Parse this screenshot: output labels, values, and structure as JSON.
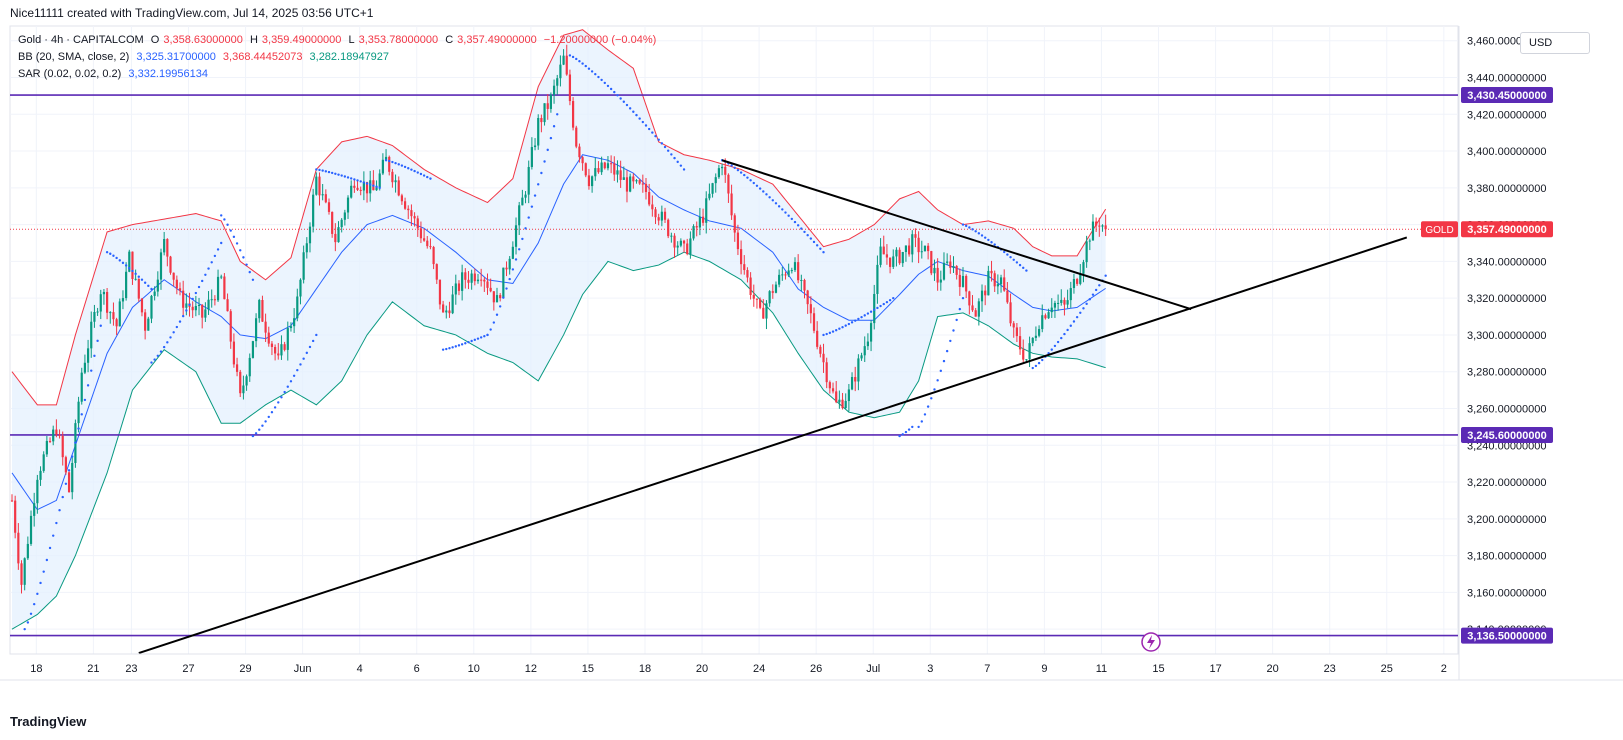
{
  "header": {
    "attribution": "Nice11111 created with TradingView.com, Jul 14, 2025 03:56 UTC+1"
  },
  "legend": {
    "symbol": "Gold · 4h · CAPITALCOM",
    "o_label": "O",
    "o_value": "3,358.63000000",
    "h_label": "H",
    "h_value": "3,359.49000000",
    "l_label": "L",
    "l_value": "3,353.78000000",
    "c_label": "C",
    "c_value": "3,357.49000000",
    "change": "−1.20000000 (−0.04%)",
    "bb_label": "BB (20, SMA, close, 2)",
    "bb_mid": "3,325.31700000",
    "bb_upper": "3,368.44452073",
    "bb_lower": "3,282.18947927",
    "sar_label": "SAR (0.02, 0.02, 0.2)",
    "sar_value": "3,332.19956134"
  },
  "currency": "USD",
  "brand": "TradingView",
  "colors": {
    "up": "#089981",
    "down": "#f23645",
    "bb_upper": "#f23645",
    "bb_lower": "#089981",
    "bb_mid": "#2962ff",
    "bb_fill": "#e3effd",
    "sar": "#2962ff",
    "level": "#5b2ab5",
    "trendline": "#000000",
    "price_line": "#f23645"
  },
  "chart_data": {
    "type": "candlestick",
    "title": "Gold · 4h · CAPITALCOM",
    "y_axis": {
      "ylim": [
        3126.5,
        3468
      ],
      "ticks": [
        3140,
        3160,
        3180,
        3200,
        3220,
        3240,
        3260,
        3280,
        3300,
        3320,
        3340,
        3360,
        3380,
        3400,
        3420,
        3440,
        3460
      ],
      "tick_labels": [
        "3,140.00000000",
        "3,160.00000000",
        "3,180.00000000",
        "3,200.00000000",
        "3,220.00000000",
        "3,240.00000000",
        "3,260.00000000",
        "3,280.00000000",
        "3,300.00000000",
        "3,320.00000000",
        "3,340.00000000",
        "3,360.00000000",
        "3,380.00000000",
        "3,400.00000000",
        "3,420.00000000",
        "3,440.00000000",
        "3,460.00000000"
      ]
    },
    "x_axis": {
      "ticks": [
        {
          "bar": 2,
          "label": "18"
        },
        {
          "bar": 20,
          "label": "21"
        },
        {
          "bar": 32,
          "label": "23"
        },
        {
          "bar": 50,
          "label": "27"
        },
        {
          "bar": 68,
          "label": "29"
        },
        {
          "bar": 86,
          "label": "Jun"
        },
        {
          "bar": 104,
          "label": "4"
        },
        {
          "bar": 122,
          "label": "6"
        },
        {
          "bar": 140,
          "label": "10"
        },
        {
          "bar": 158,
          "label": "12"
        },
        {
          "bar": 176,
          "label": "15"
        },
        {
          "bar": 194,
          "label": "18"
        },
        {
          "bar": 212,
          "label": "20"
        },
        {
          "bar": 230,
          "label": "24"
        },
        {
          "bar": 248,
          "label": "26"
        },
        {
          "bar": 266,
          "label": "Jul"
        },
        {
          "bar": 284,
          "label": "3"
        },
        {
          "bar": 302,
          "label": "7"
        },
        {
          "bar": 320,
          "label": "9"
        },
        {
          "bar": 338,
          "label": "11"
        },
        {
          "bar": 356,
          "label": "15"
        },
        {
          "bar": 374,
          "label": "17"
        },
        {
          "bar": 392,
          "label": "20"
        },
        {
          "bar": 410,
          "label": "23"
        },
        {
          "bar": 428,
          "label": "25"
        },
        {
          "bar": 446,
          "label": "2"
        }
      ]
    },
    "price_anchors": [
      {
        "bar": 0,
        "price": 3210
      },
      {
        "bar": 3,
        "price": 3165
      },
      {
        "bar": 8,
        "price": 3225
      },
      {
        "bar": 14,
        "price": 3250
      },
      {
        "bar": 18,
        "price": 3215
      },
      {
        "bar": 22,
        "price": 3280
      },
      {
        "bar": 28,
        "price": 3325
      },
      {
        "bar": 33,
        "price": 3305
      },
      {
        "bar": 37,
        "price": 3342
      },
      {
        "bar": 42,
        "price": 3305
      },
      {
        "bar": 48,
        "price": 3350
      },
      {
        "bar": 53,
        "price": 3320
      },
      {
        "bar": 60,
        "price": 3310
      },
      {
        "bar": 66,
        "price": 3330
      },
      {
        "bar": 72,
        "price": 3265
      },
      {
        "bar": 78,
        "price": 3315
      },
      {
        "bar": 84,
        "price": 3285
      },
      {
        "bar": 90,
        "price": 3318
      },
      {
        "bar": 96,
        "price": 3385
      },
      {
        "bar": 102,
        "price": 3352
      },
      {
        "bar": 108,
        "price": 3385
      },
      {
        "bar": 114,
        "price": 3378
      },
      {
        "bar": 118,
        "price": 3395
      },
      {
        "bar": 126,
        "price": 3365
      },
      {
        "bar": 132,
        "price": 3345
      },
      {
        "bar": 136,
        "price": 3310
      },
      {
        "bar": 142,
        "price": 3330
      },
      {
        "bar": 148,
        "price": 3335
      },
      {
        "bar": 153,
        "price": 3318
      },
      {
        "bar": 158,
        "price": 3352
      },
      {
        "bar": 162,
        "price": 3380
      },
      {
        "bar": 166,
        "price": 3415
      },
      {
        "bar": 170,
        "price": 3428
      },
      {
        "bar": 174,
        "price": 3450
      },
      {
        "bar": 178,
        "price": 3405
      },
      {
        "bar": 182,
        "price": 3385
      },
      {
        "bar": 188,
        "price": 3392
      },
      {
        "bar": 194,
        "price": 3382
      },
      {
        "bar": 200,
        "price": 3378
      },
      {
        "bar": 206,
        "price": 3360
      },
      {
        "bar": 212,
        "price": 3345
      },
      {
        "bar": 218,
        "price": 3365
      },
      {
        "bar": 224,
        "price": 3395
      },
      {
        "bar": 228,
        "price": 3355
      },
      {
        "bar": 232,
        "price": 3330
      },
      {
        "bar": 236,
        "price": 3310
      },
      {
        "bar": 240,
        "price": 3325
      },
      {
        "bar": 246,
        "price": 3340
      },
      {
        "bar": 252,
        "price": 3310
      },
      {
        "bar": 256,
        "price": 3285
      },
      {
        "bar": 260,
        "price": 3262
      },
      {
        "bar": 264,
        "price": 3268
      },
      {
        "bar": 270,
        "price": 3300
      },
      {
        "bar": 274,
        "price": 3345
      },
      {
        "bar": 278,
        "price": 3340
      },
      {
        "bar": 284,
        "price": 3350
      },
      {
        "bar": 288,
        "price": 3345
      },
      {
        "bar": 292,
        "price": 3330
      },
      {
        "bar": 296,
        "price": 3340
      },
      {
        "bar": 300,
        "price": 3328
      },
      {
        "bar": 304,
        "price": 3312
      },
      {
        "bar": 308,
        "price": 3330
      },
      {
        "bar": 312,
        "price": 3330
      },
      {
        "bar": 316,
        "price": 3300
      },
      {
        "bar": 320,
        "price": 3287
      },
      {
        "bar": 324,
        "price": 3308
      },
      {
        "bar": 328,
        "price": 3318
      },
      {
        "bar": 332,
        "price": 3315
      },
      {
        "bar": 336,
        "price": 3332
      },
      {
        "bar": 340,
        "price": 3355
      },
      {
        "bar": 343,
        "price": 3362
      },
      {
        "bar": 345,
        "price": 3357.49
      }
    ],
    "bollinger": {
      "upper": [
        {
          "bar": 0,
          "price": 3280
        },
        {
          "bar": 8,
          "price": 3262
        },
        {
          "bar": 14,
          "price": 3262
        },
        {
          "bar": 20,
          "price": 3300
        },
        {
          "bar": 30,
          "price": 3356
        },
        {
          "bar": 38,
          "price": 3360
        },
        {
          "bar": 48,
          "price": 3363
        },
        {
          "bar": 58,
          "price": 3366
        },
        {
          "bar": 66,
          "price": 3362
        },
        {
          "bar": 72,
          "price": 3340
        },
        {
          "bar": 80,
          "price": 3330
        },
        {
          "bar": 88,
          "price": 3342
        },
        {
          "bar": 96,
          "price": 3390
        },
        {
          "bar": 104,
          "price": 3405
        },
        {
          "bar": 112,
          "price": 3408
        },
        {
          "bar": 120,
          "price": 3403
        },
        {
          "bar": 130,
          "price": 3390
        },
        {
          "bar": 140,
          "price": 3380
        },
        {
          "bar": 150,
          "price": 3372
        },
        {
          "bar": 158,
          "price": 3385
        },
        {
          "bar": 166,
          "price": 3435
        },
        {
          "bar": 174,
          "price": 3463
        },
        {
          "bar": 180,
          "price": 3466
        },
        {
          "bar": 188,
          "price": 3455
        },
        {
          "bar": 196,
          "price": 3445
        },
        {
          "bar": 204,
          "price": 3405
        },
        {
          "bar": 212,
          "price": 3398
        },
        {
          "bar": 220,
          "price": 3395
        },
        {
          "bar": 230,
          "price": 3390
        },
        {
          "bar": 240,
          "price": 3382
        },
        {
          "bar": 248,
          "price": 3365
        },
        {
          "bar": 256,
          "price": 3348
        },
        {
          "bar": 264,
          "price": 3352
        },
        {
          "bar": 272,
          "price": 3360
        },
        {
          "bar": 280,
          "price": 3374
        },
        {
          "bar": 286,
          "price": 3378
        },
        {
          "bar": 292,
          "price": 3368
        },
        {
          "bar": 300,
          "price": 3360
        },
        {
          "bar": 308,
          "price": 3362
        },
        {
          "bar": 316,
          "price": 3358
        },
        {
          "bar": 322,
          "price": 3348
        },
        {
          "bar": 328,
          "price": 3343
        },
        {
          "bar": 336,
          "price": 3343
        },
        {
          "bar": 345,
          "price": 3368.44
        }
      ],
      "middle": [
        {
          "bar": 0,
          "price": 3225
        },
        {
          "bar": 8,
          "price": 3205
        },
        {
          "bar": 14,
          "price": 3210
        },
        {
          "bar": 20,
          "price": 3240
        },
        {
          "bar": 30,
          "price": 3290
        },
        {
          "bar": 38,
          "price": 3315
        },
        {
          "bar": 48,
          "price": 3330
        },
        {
          "bar": 58,
          "price": 3318
        },
        {
          "bar": 66,
          "price": 3310
        },
        {
          "bar": 72,
          "price": 3300
        },
        {
          "bar": 80,
          "price": 3298
        },
        {
          "bar": 88,
          "price": 3305
        },
        {
          "bar": 96,
          "price": 3325
        },
        {
          "bar": 104,
          "price": 3345
        },
        {
          "bar": 112,
          "price": 3360
        },
        {
          "bar": 120,
          "price": 3365
        },
        {
          "bar": 130,
          "price": 3358
        },
        {
          "bar": 140,
          "price": 3345
        },
        {
          "bar": 150,
          "price": 3330
        },
        {
          "bar": 158,
          "price": 3328
        },
        {
          "bar": 166,
          "price": 3350
        },
        {
          "bar": 174,
          "price": 3382
        },
        {
          "bar": 180,
          "price": 3398
        },
        {
          "bar": 188,
          "price": 3395
        },
        {
          "bar": 196,
          "price": 3388
        },
        {
          "bar": 204,
          "price": 3375
        },
        {
          "bar": 212,
          "price": 3368
        },
        {
          "bar": 220,
          "price": 3362
        },
        {
          "bar": 230,
          "price": 3358
        },
        {
          "bar": 240,
          "price": 3345
        },
        {
          "bar": 248,
          "price": 3325
        },
        {
          "bar": 256,
          "price": 3315
        },
        {
          "bar": 264,
          "price": 3308
        },
        {
          "bar": 272,
          "price": 3308
        },
        {
          "bar": 280,
          "price": 3322
        },
        {
          "bar": 286,
          "price": 3333
        },
        {
          "bar": 292,
          "price": 3340
        },
        {
          "bar": 300,
          "price": 3335
        },
        {
          "bar": 308,
          "price": 3332
        },
        {
          "bar": 316,
          "price": 3322
        },
        {
          "bar": 322,
          "price": 3315
        },
        {
          "bar": 328,
          "price": 3313
        },
        {
          "bar": 336,
          "price": 3315
        },
        {
          "bar": 345,
          "price": 3325.32
        }
      ],
      "lower": [
        {
          "bar": 0,
          "price": 3140
        },
        {
          "bar": 8,
          "price": 3148
        },
        {
          "bar": 14,
          "price": 3158
        },
        {
          "bar": 20,
          "price": 3180
        },
        {
          "bar": 30,
          "price": 3225
        },
        {
          "bar": 38,
          "price": 3270
        },
        {
          "bar": 48,
          "price": 3292
        },
        {
          "bar": 58,
          "price": 3280
        },
        {
          "bar": 66,
          "price": 3252
        },
        {
          "bar": 72,
          "price": 3252
        },
        {
          "bar": 80,
          "price": 3262
        },
        {
          "bar": 88,
          "price": 3270
        },
        {
          "bar": 96,
          "price": 3262
        },
        {
          "bar": 104,
          "price": 3275
        },
        {
          "bar": 112,
          "price": 3300
        },
        {
          "bar": 120,
          "price": 3318
        },
        {
          "bar": 130,
          "price": 3305
        },
        {
          "bar": 140,
          "price": 3300
        },
        {
          "bar": 150,
          "price": 3290
        },
        {
          "bar": 158,
          "price": 3285
        },
        {
          "bar": 166,
          "price": 3275
        },
        {
          "bar": 174,
          "price": 3300
        },
        {
          "bar": 180,
          "price": 3322
        },
        {
          "bar": 188,
          "price": 3340
        },
        {
          "bar": 196,
          "price": 3335
        },
        {
          "bar": 204,
          "price": 3338
        },
        {
          "bar": 212,
          "price": 3345
        },
        {
          "bar": 220,
          "price": 3340
        },
        {
          "bar": 230,
          "price": 3330
        },
        {
          "bar": 240,
          "price": 3312
        },
        {
          "bar": 248,
          "price": 3290
        },
        {
          "bar": 256,
          "price": 3270
        },
        {
          "bar": 264,
          "price": 3258
        },
        {
          "bar": 272,
          "price": 3255
        },
        {
          "bar": 280,
          "price": 3258
        },
        {
          "bar": 286,
          "price": 3275
        },
        {
          "bar": 292,
          "price": 3310
        },
        {
          "bar": 300,
          "price": 3312
        },
        {
          "bar": 308,
          "price": 3305
        },
        {
          "bar": 316,
          "price": 3295
        },
        {
          "bar": 322,
          "price": 3290
        },
        {
          "bar": 328,
          "price": 3288
        },
        {
          "bar": 336,
          "price": 3287
        },
        {
          "bar": 345,
          "price": 3282.19
        }
      ]
    },
    "sar_segments": [
      {
        "from_bar": 4,
        "to_bar": 28,
        "start": 3140,
        "end": 3305
      },
      {
        "from_bar": 30,
        "to_bar": 44,
        "start": 3345,
        "end": 3325
      },
      {
        "from_bar": 44,
        "to_bar": 66,
        "start": 3285,
        "end": 3350
      },
      {
        "from_bar": 66,
        "to_bar": 76,
        "start": 3365,
        "end": 3330
      },
      {
        "from_bar": 76,
        "to_bar": 96,
        "start": 3245,
        "end": 3300
      },
      {
        "from_bar": 96,
        "to_bar": 116,
        "start": 3390,
        "end": 3380
      },
      {
        "from_bar": 118,
        "to_bar": 132,
        "start": 3395,
        "end": 3385
      },
      {
        "from_bar": 136,
        "to_bar": 150,
        "start": 3292,
        "end": 3300
      },
      {
        "from_bar": 150,
        "to_bar": 172,
        "start": 3300,
        "end": 3420
      },
      {
        "from_bar": 176,
        "to_bar": 212,
        "start": 3452,
        "end": 3390
      },
      {
        "from_bar": 224,
        "to_bar": 256,
        "start": 3395,
        "end": 3345
      },
      {
        "from_bar": 256,
        "to_bar": 278,
        "start": 3300,
        "end": 3320
      },
      {
        "from_bar": 280,
        "to_bar": 284,
        "start": 3245,
        "end": 3250
      },
      {
        "from_bar": 286,
        "to_bar": 300,
        "start": 3250,
        "end": 3320
      },
      {
        "from_bar": 300,
        "to_bar": 320,
        "start": 3360,
        "end": 3335
      },
      {
        "from_bar": 322,
        "to_bar": 345,
        "start": 3282,
        "end": 3332.2
      }
    ],
    "levels": [
      {
        "price": 3430.45,
        "label": "3,430.45000000"
      },
      {
        "price": 3245.6,
        "label": "3,245.60000000"
      },
      {
        "price": 3136.5,
        "label": "3,136.50000000"
      }
    ],
    "trendlines": [
      {
        "from_bar": 224,
        "from_price": 3395,
        "to_bar": 372,
        "to_price": 3314
      },
      {
        "from_bar": 40,
        "from_price": 3127,
        "to_bar": 440,
        "to_price": 3353
      }
    ],
    "last_price": {
      "price": 3357.49,
      "symbol": "GOLD",
      "label": "3,357.49000000"
    }
  }
}
